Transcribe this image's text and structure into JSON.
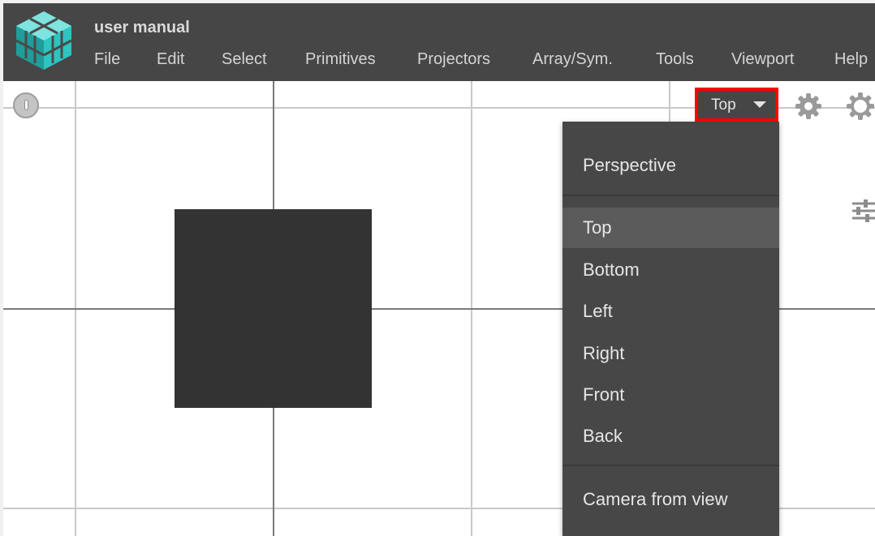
{
  "app": {
    "title": "user manual",
    "logo_name": "app-logo",
    "accent_color": "#2ec4c0"
  },
  "menubar": {
    "items": [
      {
        "label": "File"
      },
      {
        "label": "Edit"
      },
      {
        "label": "Select"
      },
      {
        "label": "Primitives"
      },
      {
        "label": "Projectors"
      },
      {
        "label": "Array/Sym."
      },
      {
        "label": "Tools"
      },
      {
        "label": "Viewport"
      },
      {
        "label": "Help"
      }
    ]
  },
  "viewport": {
    "camera_select": {
      "value": "Top",
      "highlight_color": "#ff0000"
    },
    "icons": [
      "warning-icon",
      "gear-icon",
      "lightbulb-icon",
      "sliders-icon"
    ],
    "object_color": "#333333"
  },
  "camera_menu": {
    "perspective": "Perspective",
    "views": [
      {
        "label": "Top",
        "selected": true
      },
      {
        "label": "Bottom",
        "selected": false
      },
      {
        "label": "Left",
        "selected": false
      },
      {
        "label": "Right",
        "selected": false
      },
      {
        "label": "Front",
        "selected": false
      },
      {
        "label": "Back",
        "selected": false
      }
    ],
    "camera_from_view": "Camera from view"
  }
}
